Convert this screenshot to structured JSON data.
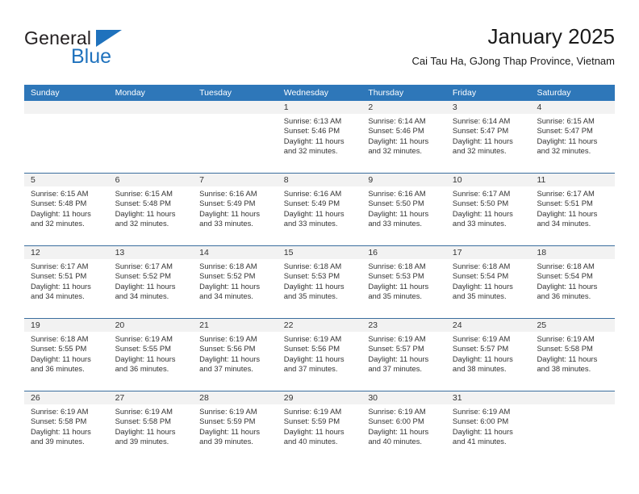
{
  "logo": {
    "word_top": "General",
    "word_bottom": "Blue",
    "triangle_icon": "logo-triangle-icon",
    "accent_color": "#1f72bd"
  },
  "header": {
    "title": "January 2025",
    "subtitle": "Cai Tau Ha, GJong Thap Province, Vietnam",
    "header_bg_color": "#2e77b9",
    "date_band_color": "#f2f2f2"
  },
  "weekday_headers": [
    "Sunday",
    "Monday",
    "Tuesday",
    "Wednesday",
    "Thursday",
    "Friday",
    "Saturday"
  ],
  "weeks": [
    [
      {
        "day": "",
        "sunrise": "",
        "sunset": "",
        "daylight_line1": "",
        "daylight_line2": ""
      },
      {
        "day": "",
        "sunrise": "",
        "sunset": "",
        "daylight_line1": "",
        "daylight_line2": ""
      },
      {
        "day": "",
        "sunrise": "",
        "sunset": "",
        "daylight_line1": "",
        "daylight_line2": ""
      },
      {
        "day": "1",
        "sunrise": "Sunrise: 6:13 AM",
        "sunset": "Sunset: 5:46 PM",
        "daylight_line1": "Daylight: 11 hours",
        "daylight_line2": "and 32 minutes."
      },
      {
        "day": "2",
        "sunrise": "Sunrise: 6:14 AM",
        "sunset": "Sunset: 5:46 PM",
        "daylight_line1": "Daylight: 11 hours",
        "daylight_line2": "and 32 minutes."
      },
      {
        "day": "3",
        "sunrise": "Sunrise: 6:14 AM",
        "sunset": "Sunset: 5:47 PM",
        "daylight_line1": "Daylight: 11 hours",
        "daylight_line2": "and 32 minutes."
      },
      {
        "day": "4",
        "sunrise": "Sunrise: 6:15 AM",
        "sunset": "Sunset: 5:47 PM",
        "daylight_line1": "Daylight: 11 hours",
        "daylight_line2": "and 32 minutes."
      }
    ],
    [
      {
        "day": "5",
        "sunrise": "Sunrise: 6:15 AM",
        "sunset": "Sunset: 5:48 PM",
        "daylight_line1": "Daylight: 11 hours",
        "daylight_line2": "and 32 minutes."
      },
      {
        "day": "6",
        "sunrise": "Sunrise: 6:15 AM",
        "sunset": "Sunset: 5:48 PM",
        "daylight_line1": "Daylight: 11 hours",
        "daylight_line2": "and 32 minutes."
      },
      {
        "day": "7",
        "sunrise": "Sunrise: 6:16 AM",
        "sunset": "Sunset: 5:49 PM",
        "daylight_line1": "Daylight: 11 hours",
        "daylight_line2": "and 33 minutes."
      },
      {
        "day": "8",
        "sunrise": "Sunrise: 6:16 AM",
        "sunset": "Sunset: 5:49 PM",
        "daylight_line1": "Daylight: 11 hours",
        "daylight_line2": "and 33 minutes."
      },
      {
        "day": "9",
        "sunrise": "Sunrise: 6:16 AM",
        "sunset": "Sunset: 5:50 PM",
        "daylight_line1": "Daylight: 11 hours",
        "daylight_line2": "and 33 minutes."
      },
      {
        "day": "10",
        "sunrise": "Sunrise: 6:17 AM",
        "sunset": "Sunset: 5:50 PM",
        "daylight_line1": "Daylight: 11 hours",
        "daylight_line2": "and 33 minutes."
      },
      {
        "day": "11",
        "sunrise": "Sunrise: 6:17 AM",
        "sunset": "Sunset: 5:51 PM",
        "daylight_line1": "Daylight: 11 hours",
        "daylight_line2": "and 34 minutes."
      }
    ],
    [
      {
        "day": "12",
        "sunrise": "Sunrise: 6:17 AM",
        "sunset": "Sunset: 5:51 PM",
        "daylight_line1": "Daylight: 11 hours",
        "daylight_line2": "and 34 minutes."
      },
      {
        "day": "13",
        "sunrise": "Sunrise: 6:17 AM",
        "sunset": "Sunset: 5:52 PM",
        "daylight_line1": "Daylight: 11 hours",
        "daylight_line2": "and 34 minutes."
      },
      {
        "day": "14",
        "sunrise": "Sunrise: 6:18 AM",
        "sunset": "Sunset: 5:52 PM",
        "daylight_line1": "Daylight: 11 hours",
        "daylight_line2": "and 34 minutes."
      },
      {
        "day": "15",
        "sunrise": "Sunrise: 6:18 AM",
        "sunset": "Sunset: 5:53 PM",
        "daylight_line1": "Daylight: 11 hours",
        "daylight_line2": "and 35 minutes."
      },
      {
        "day": "16",
        "sunrise": "Sunrise: 6:18 AM",
        "sunset": "Sunset: 5:53 PM",
        "daylight_line1": "Daylight: 11 hours",
        "daylight_line2": "and 35 minutes."
      },
      {
        "day": "17",
        "sunrise": "Sunrise: 6:18 AM",
        "sunset": "Sunset: 5:54 PM",
        "daylight_line1": "Daylight: 11 hours",
        "daylight_line2": "and 35 minutes."
      },
      {
        "day": "18",
        "sunrise": "Sunrise: 6:18 AM",
        "sunset": "Sunset: 5:54 PM",
        "daylight_line1": "Daylight: 11 hours",
        "daylight_line2": "and 36 minutes."
      }
    ],
    [
      {
        "day": "19",
        "sunrise": "Sunrise: 6:18 AM",
        "sunset": "Sunset: 5:55 PM",
        "daylight_line1": "Daylight: 11 hours",
        "daylight_line2": "and 36 minutes."
      },
      {
        "day": "20",
        "sunrise": "Sunrise: 6:19 AM",
        "sunset": "Sunset: 5:55 PM",
        "daylight_line1": "Daylight: 11 hours",
        "daylight_line2": "and 36 minutes."
      },
      {
        "day": "21",
        "sunrise": "Sunrise: 6:19 AM",
        "sunset": "Sunset: 5:56 PM",
        "daylight_line1": "Daylight: 11 hours",
        "daylight_line2": "and 37 minutes."
      },
      {
        "day": "22",
        "sunrise": "Sunrise: 6:19 AM",
        "sunset": "Sunset: 5:56 PM",
        "daylight_line1": "Daylight: 11 hours",
        "daylight_line2": "and 37 minutes."
      },
      {
        "day": "23",
        "sunrise": "Sunrise: 6:19 AM",
        "sunset": "Sunset: 5:57 PM",
        "daylight_line1": "Daylight: 11 hours",
        "daylight_line2": "and 37 minutes."
      },
      {
        "day": "24",
        "sunrise": "Sunrise: 6:19 AM",
        "sunset": "Sunset: 5:57 PM",
        "daylight_line1": "Daylight: 11 hours",
        "daylight_line2": "and 38 minutes."
      },
      {
        "day": "25",
        "sunrise": "Sunrise: 6:19 AM",
        "sunset": "Sunset: 5:58 PM",
        "daylight_line1": "Daylight: 11 hours",
        "daylight_line2": "and 38 minutes."
      }
    ],
    [
      {
        "day": "26",
        "sunrise": "Sunrise: 6:19 AM",
        "sunset": "Sunset: 5:58 PM",
        "daylight_line1": "Daylight: 11 hours",
        "daylight_line2": "and 39 minutes."
      },
      {
        "day": "27",
        "sunrise": "Sunrise: 6:19 AM",
        "sunset": "Sunset: 5:58 PM",
        "daylight_line1": "Daylight: 11 hours",
        "daylight_line2": "and 39 minutes."
      },
      {
        "day": "28",
        "sunrise": "Sunrise: 6:19 AM",
        "sunset": "Sunset: 5:59 PM",
        "daylight_line1": "Daylight: 11 hours",
        "daylight_line2": "and 39 minutes."
      },
      {
        "day": "29",
        "sunrise": "Sunrise: 6:19 AM",
        "sunset": "Sunset: 5:59 PM",
        "daylight_line1": "Daylight: 11 hours",
        "daylight_line2": "and 40 minutes."
      },
      {
        "day": "30",
        "sunrise": "Sunrise: 6:19 AM",
        "sunset": "Sunset: 6:00 PM",
        "daylight_line1": "Daylight: 11 hours",
        "daylight_line2": "and 40 minutes."
      },
      {
        "day": "31",
        "sunrise": "Sunrise: 6:19 AM",
        "sunset": "Sunset: 6:00 PM",
        "daylight_line1": "Daylight: 11 hours",
        "daylight_line2": "and 41 minutes."
      },
      {
        "day": "",
        "sunrise": "",
        "sunset": "",
        "daylight_line1": "",
        "daylight_line2": ""
      }
    ]
  ]
}
